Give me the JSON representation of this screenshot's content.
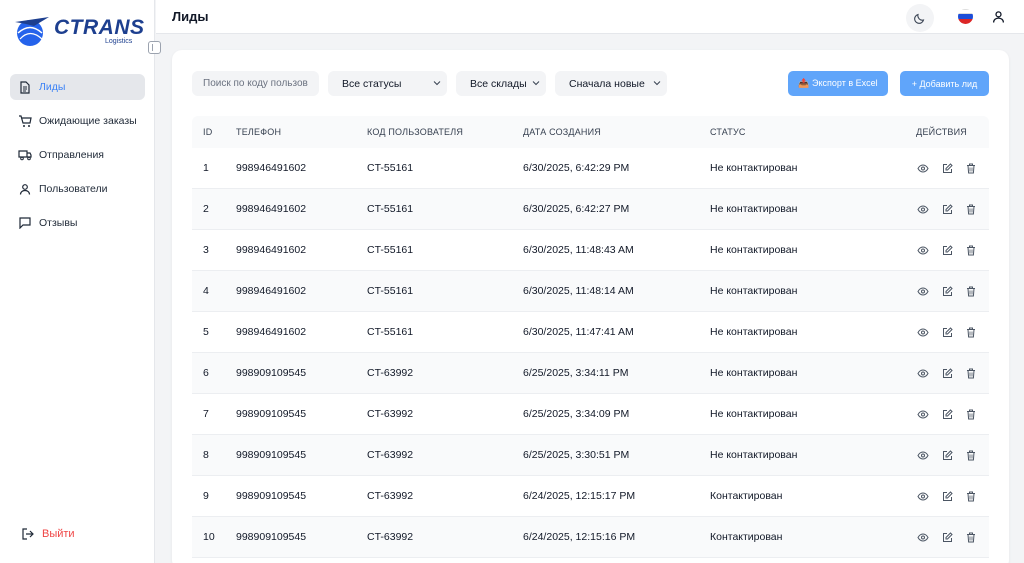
{
  "brand": {
    "name": "CTRANS",
    "sub": "Logistics"
  },
  "sidebar": {
    "items": [
      {
        "label": "Лиды",
        "icon": "document-icon",
        "active": true
      },
      {
        "label": "Ожидающие заказы",
        "icon": "cart-icon",
        "active": false
      },
      {
        "label": "Отправления",
        "icon": "truck-icon",
        "active": false
      },
      {
        "label": "Пользователи",
        "icon": "user-icon",
        "active": false
      },
      {
        "label": "Отзывы",
        "icon": "message-icon",
        "active": false
      }
    ],
    "logout": "Выйти"
  },
  "header": {
    "title": "Лиды"
  },
  "filters": {
    "search_placeholder": "Поиск по коду пользов",
    "status": "Все статусы",
    "warehouse": "Все склады",
    "sort": "Сначала новые",
    "export": "📤 Экспорт в Excel",
    "add": "+ Добавить лид"
  },
  "table": {
    "columns": [
      "ID",
      "ТЕЛЕФОН",
      "КОД ПОЛЬЗОВАТЕЛЯ",
      "ДАТА СОЗДАНИЯ",
      "СТАТУС",
      "ДЕЙСТВИЯ"
    ],
    "rows": [
      {
        "id": "1",
        "phone": "998946491602",
        "user": "CT-55161",
        "date": "6/30/2025, 6:42:29 PM",
        "status": "Не контактирован"
      },
      {
        "id": "2",
        "phone": "998946491602",
        "user": "CT-55161",
        "date": "6/30/2025, 6:42:27 PM",
        "status": "Не контактирован"
      },
      {
        "id": "3",
        "phone": "998946491602",
        "user": "CT-55161",
        "date": "6/30/2025, 11:48:43 AM",
        "status": "Не контактирован"
      },
      {
        "id": "4",
        "phone": "998946491602",
        "user": "CT-55161",
        "date": "6/30/2025, 11:48:14 AM",
        "status": "Не контактирован"
      },
      {
        "id": "5",
        "phone": "998946491602",
        "user": "CT-55161",
        "date": "6/30/2025, 11:47:41 AM",
        "status": "Не контактирован"
      },
      {
        "id": "6",
        "phone": "998909109545",
        "user": "CT-63992",
        "date": "6/25/2025, 3:34:11 PM",
        "status": "Не контактирован"
      },
      {
        "id": "7",
        "phone": "998909109545",
        "user": "CT-63992",
        "date": "6/25/2025, 3:34:09 PM",
        "status": "Не контактирован"
      },
      {
        "id": "8",
        "phone": "998909109545",
        "user": "CT-63992",
        "date": "6/25/2025, 3:30:51 PM",
        "status": "Не контактирован"
      },
      {
        "id": "9",
        "phone": "998909109545",
        "user": "CT-63992",
        "date": "6/24/2025, 12:15:17 PM",
        "status": "Контактирован"
      },
      {
        "id": "10",
        "phone": "998909109545",
        "user": "CT-63992",
        "date": "6/24/2025, 12:15:16 PM",
        "status": "Контактирован"
      }
    ]
  },
  "colors": {
    "accent": "#3b82f6",
    "button": "#60a5fa",
    "logout": "#ef4444",
    "brand": "#1d3f8f"
  }
}
